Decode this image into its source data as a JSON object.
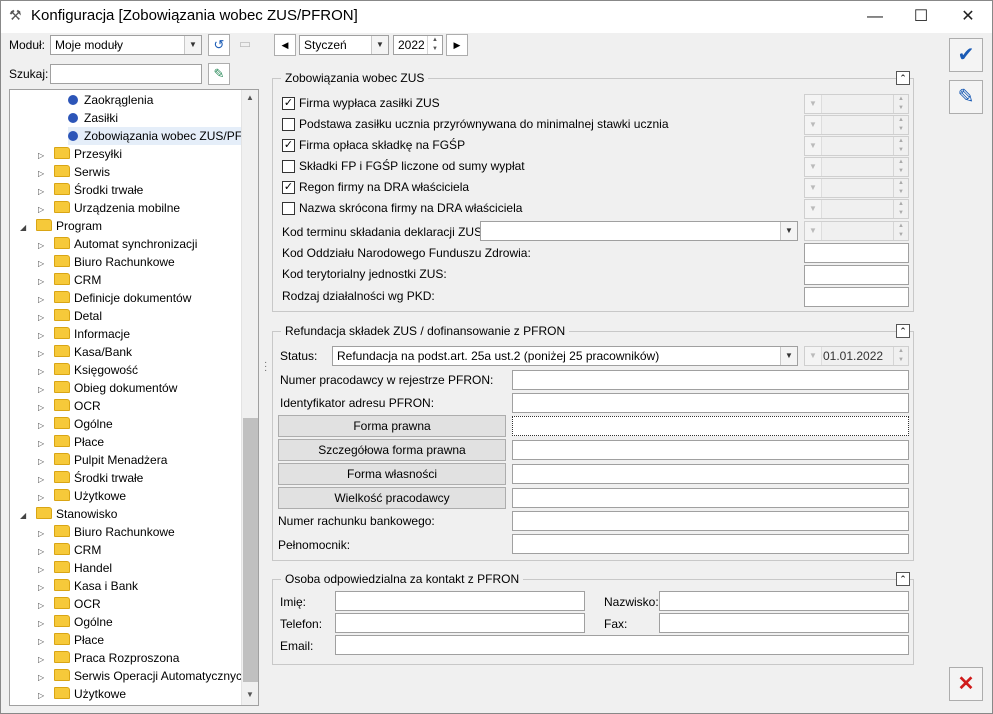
{
  "window": {
    "title": "Konfiguracja [Zobowiązania wobec ZUS/PFRON]",
    "minimize": "—",
    "maximize": "☐",
    "close": "✕"
  },
  "left": {
    "module_label": "Moduł:",
    "module_value": "Moje moduły",
    "search_label": "Szukaj:",
    "search_value": ""
  },
  "tree": {
    "items": [
      {
        "label": "Zaokrąglenia",
        "level": 2,
        "type": "leaf"
      },
      {
        "label": "Zasiłki",
        "level": 2,
        "type": "leaf"
      },
      {
        "label": "Zobowiązania wobec ZUS/PF...",
        "level": 2,
        "type": "leaf",
        "selected": true
      },
      {
        "label": "Przesyłki",
        "level": 1,
        "type": "folder"
      },
      {
        "label": "Serwis",
        "level": 1,
        "type": "folder"
      },
      {
        "label": "Środki trwałe",
        "level": 1,
        "type": "folder"
      },
      {
        "label": "Urządzenia mobilne",
        "level": 1,
        "type": "folder"
      },
      {
        "label": "Program",
        "level": 0,
        "type": "folder",
        "expanded": true
      },
      {
        "label": "Automat synchronizacji",
        "level": 1,
        "type": "folder"
      },
      {
        "label": "Biuro Rachunkowe",
        "level": 1,
        "type": "folder"
      },
      {
        "label": "CRM",
        "level": 1,
        "type": "folder"
      },
      {
        "label": "Definicje dokumentów",
        "level": 1,
        "type": "folder"
      },
      {
        "label": "Detal",
        "level": 1,
        "type": "folder"
      },
      {
        "label": "Informacje",
        "level": 1,
        "type": "folder"
      },
      {
        "label": "Kasa/Bank",
        "level": 1,
        "type": "folder"
      },
      {
        "label": "Księgowość",
        "level": 1,
        "type": "folder"
      },
      {
        "label": "Obieg dokumentów",
        "level": 1,
        "type": "folder"
      },
      {
        "label": "OCR",
        "level": 1,
        "type": "folder"
      },
      {
        "label": "Ogólne",
        "level": 1,
        "type": "folder"
      },
      {
        "label": "Płace",
        "level": 1,
        "type": "folder"
      },
      {
        "label": "Pulpit Menadżera",
        "level": 1,
        "type": "folder"
      },
      {
        "label": "Środki trwałe",
        "level": 1,
        "type": "folder"
      },
      {
        "label": "Użytkowe",
        "level": 1,
        "type": "folder"
      },
      {
        "label": "Stanowisko",
        "level": 0,
        "type": "folder",
        "expanded": true
      },
      {
        "label": "Biuro Rachunkowe",
        "level": 1,
        "type": "folder"
      },
      {
        "label": "CRM",
        "level": 1,
        "type": "folder"
      },
      {
        "label": "Handel",
        "level": 1,
        "type": "folder"
      },
      {
        "label": "Kasa i Bank",
        "level": 1,
        "type": "folder"
      },
      {
        "label": "OCR",
        "level": 1,
        "type": "folder"
      },
      {
        "label": "Ogólne",
        "level": 1,
        "type": "folder"
      },
      {
        "label": "Płace",
        "level": 1,
        "type": "folder"
      },
      {
        "label": "Praca Rozproszona",
        "level": 1,
        "type": "folder"
      },
      {
        "label": "Serwis Operacji Automatycznych",
        "level": 1,
        "type": "folder"
      },
      {
        "label": "Użytkowe",
        "level": 1,
        "type": "folder"
      }
    ]
  },
  "period": {
    "month": "Styczeń",
    "year": "2022"
  },
  "zus": {
    "title": "Zobowiązania wobec ZUS",
    "checks": [
      {
        "label": "Firma wypłaca zasiłki ZUS",
        "checked": true
      },
      {
        "label": "Podstawa zasiłku ucznia przyrównywana do minimalnej stawki ucznia",
        "checked": false
      },
      {
        "label": "Firma opłaca składkę na FGŚP",
        "checked": true
      },
      {
        "label": "Składki FP i FGŚP liczone od sumy wypłat",
        "checked": false
      },
      {
        "label": "Regon firmy na DRA właściciela",
        "checked": true
      },
      {
        "label": "Nazwa skrócona firmy na DRA właściciela",
        "checked": false
      }
    ],
    "kod_terminu_label": "Kod terminu składania deklaracji ZUS:",
    "kod_terminu_value": "",
    "kod_nfz_label": "Kod Oddziału Narodowego Funduszu Zdrowia:",
    "kod_nfz_value": "",
    "kod_zus_label": "Kod terytorialny jednostki ZUS:",
    "kod_zus_value": "",
    "pkd_label": "Rodzaj działalności wg PKD:",
    "pkd_value": ""
  },
  "pfron": {
    "title": "Refundacja składek ZUS / dofinansowanie z PFRON",
    "status_label": "Status:",
    "status_value": "Refundacja na podst.art. 25a ust.2 (poniżej 25 pracowników)",
    "status_date": "01.01.2022",
    "numer_label": "Numer pracodawcy w rejestrze PFRON:",
    "identyfikator_label": "Identyfikator adresu PFRON:",
    "forma_prawna_btn": "Forma prawna",
    "szczegolowa_btn": "Szczegółowa forma prawna",
    "forma_wlasnosci_btn": "Forma własności",
    "wielkosc_btn": "Wielkość pracodawcy",
    "rachunek_label": "Numer rachunku bankowego:",
    "pelnomocnik_label": "Pełnomocnik:"
  },
  "contact": {
    "title": "Osoba odpowiedzialna za kontakt z PFRON",
    "imie_label": "Imię:",
    "nazwisko_label": "Nazwisko:",
    "telefon_label": "Telefon:",
    "fax_label": "Fax:",
    "email_label": "Email:"
  }
}
